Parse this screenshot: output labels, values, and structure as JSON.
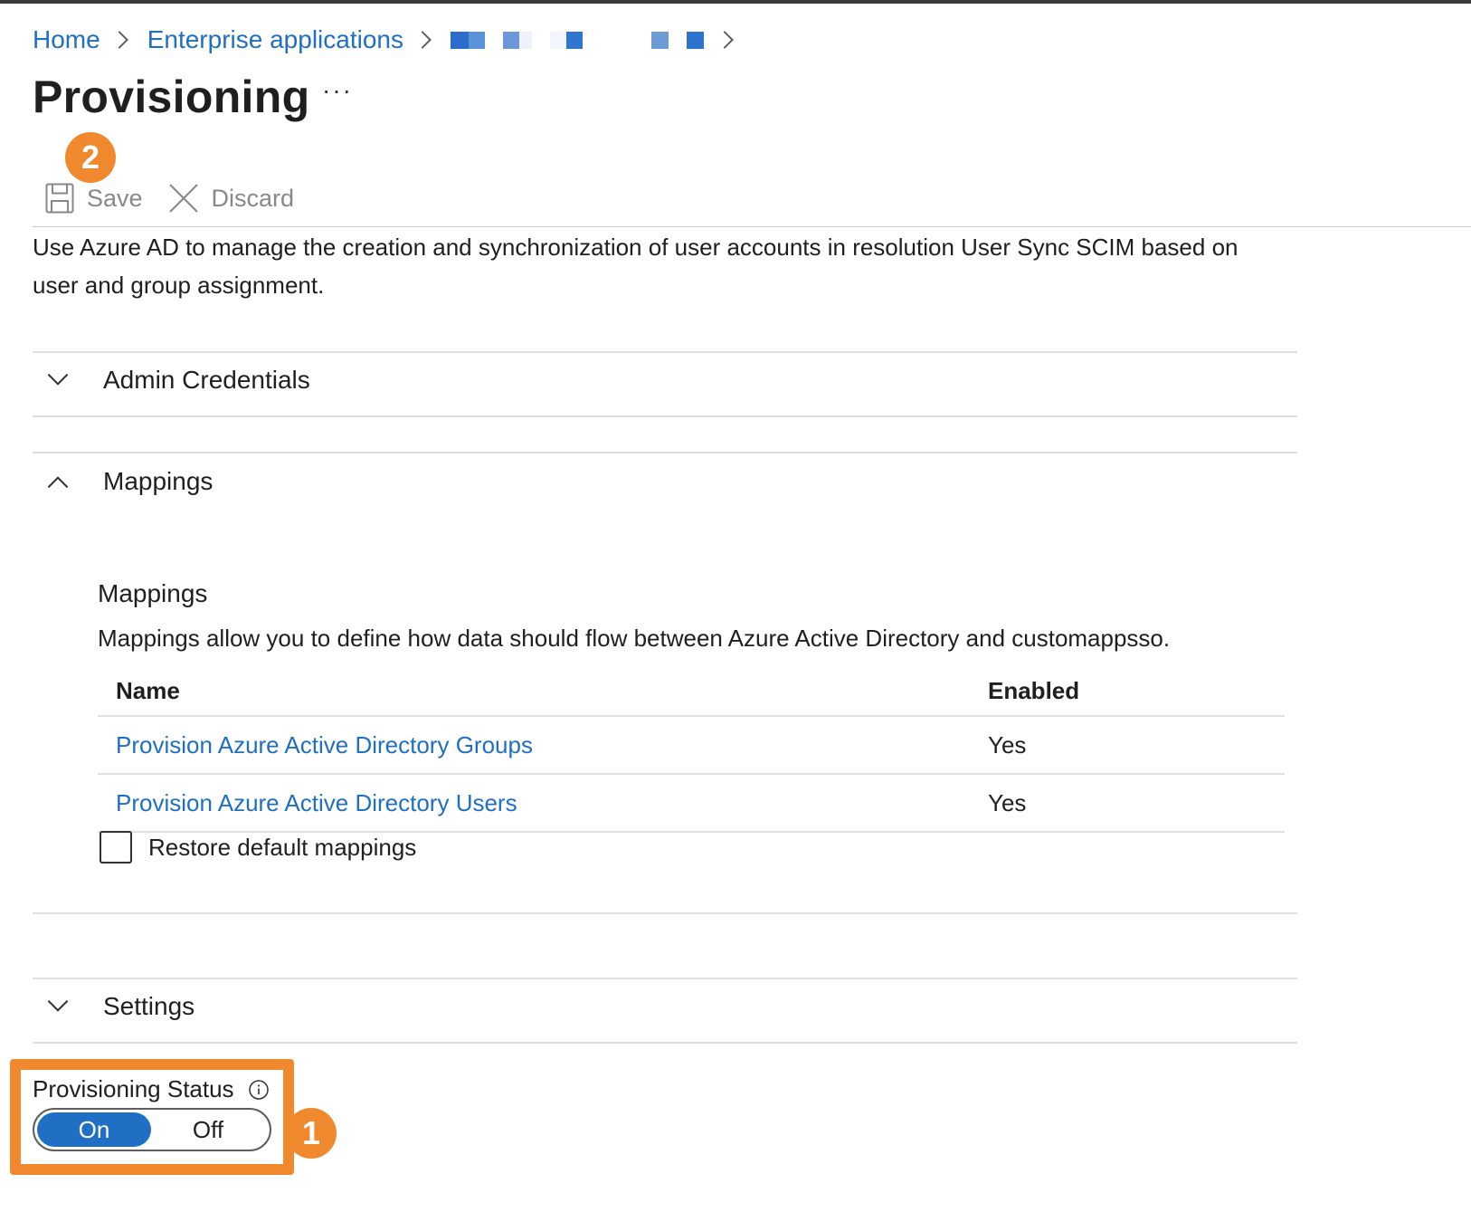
{
  "breadcrumb": {
    "home": "Home",
    "enterprise": "Enterprise applications"
  },
  "page": {
    "title": "Provisioning",
    "more": "···"
  },
  "badges": {
    "step1": "1",
    "step2": "2"
  },
  "toolbar": {
    "save_label": "Save",
    "discard_label": "Discard"
  },
  "description": "Use Azure AD to manage the creation and synchronization of user accounts in resolution User Sync SCIM based on user and group assignment.",
  "sections": {
    "admin_credentials": "Admin Credentials",
    "mappings": "Mappings",
    "settings": "Settings"
  },
  "mappings": {
    "title": "Mappings",
    "description": "Mappings allow you to define how data should flow between Azure Active Directory and customappsso.",
    "columns": {
      "name": "Name",
      "enabled": "Enabled"
    },
    "rows": [
      {
        "name": "Provision Azure Active Directory Groups",
        "enabled": "Yes"
      },
      {
        "name": "Provision Azure Active Directory Users",
        "enabled": "Yes"
      }
    ],
    "restore_label": "Restore default mappings"
  },
  "provisioning_status": {
    "label": "Provisioning Status",
    "on": "On",
    "off": "Off",
    "selected": "On"
  },
  "colors": {
    "link": "#1f6fc5",
    "accent_orange": "#f0892e",
    "toggle_on": "#1f6fc5"
  }
}
